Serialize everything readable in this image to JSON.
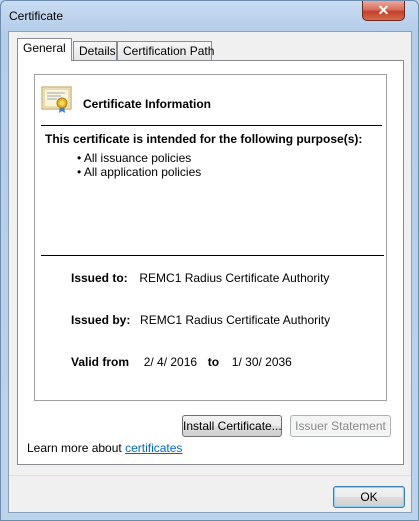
{
  "window": {
    "title": "Certificate",
    "close_glyph": "✕"
  },
  "tabs": [
    {
      "label": "General",
      "active": true
    },
    {
      "label": "Details",
      "active": false
    },
    {
      "label": "Certification Path",
      "active": false
    }
  ],
  "info": {
    "icon": "certificate-icon",
    "title": "Certificate Information",
    "purpose_heading": "This certificate is intended for the following purpose(s):",
    "policies": [
      "All issuance policies",
      "All application policies"
    ],
    "issued_to_label": "Issued to:",
    "issued_to_value": "REMC1 Radius Certificate Authority",
    "issued_by_label": "Issued by:",
    "issued_by_value": "REMC1 Radius Certificate Authority",
    "valid_from_label": "Valid from",
    "valid_from_value": "2/ 4/ 2016",
    "valid_to_label": "to",
    "valid_to_value": "1/ 30/ 2036"
  },
  "buttons": {
    "install": "Install Certificate...",
    "issuer_statement": "Issuer Statement",
    "ok": "OK"
  },
  "learn_more": {
    "prefix": "Learn more about ",
    "link": "certificates"
  }
}
